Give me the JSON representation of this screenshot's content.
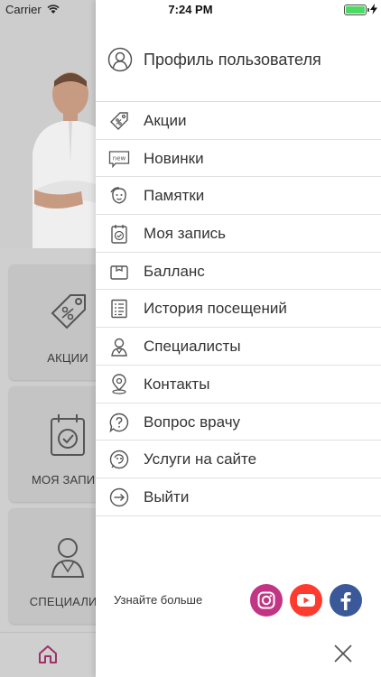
{
  "status_bar": {
    "carrier": "Carrier",
    "time": "7:24 PM",
    "battery_level": 1.0
  },
  "background": {
    "tiles": [
      {
        "label": "АКЦИИ",
        "icon": "tag-icon"
      },
      {
        "label": "МОЯ ЗАПИС",
        "icon": "calendar-check-icon"
      },
      {
        "label": "СПЕЦИАЛИС",
        "icon": "specialist-icon"
      }
    ],
    "bottom_nav": {
      "icon": "home-icon",
      "color": "#a0306a"
    }
  },
  "drawer": {
    "profile_label": "Профиль пользователя",
    "menu": [
      {
        "label": "Акции",
        "icon": "tag-icon"
      },
      {
        "label": "Новинки",
        "icon": "new-icon"
      },
      {
        "label": "Памятки",
        "icon": "memo-face-icon"
      },
      {
        "label": "Моя запись",
        "icon": "calendar-check-icon"
      },
      {
        "label": "Балланс",
        "icon": "wallet-icon"
      },
      {
        "label": "История посещений",
        "icon": "history-list-icon"
      },
      {
        "label": "Специалисты",
        "icon": "specialist-icon"
      },
      {
        "label": "Контакты",
        "icon": "location-pin-icon"
      },
      {
        "label": "Вопрос врачу",
        "icon": "question-bubble-icon"
      },
      {
        "label": "Услуги на сайте",
        "icon": "services-icon"
      },
      {
        "label": "Выйти",
        "icon": "logout-icon"
      }
    ],
    "learn_more": "Узнайте больше",
    "social": [
      {
        "name": "instagram",
        "color": "#c13584"
      },
      {
        "name": "youtube",
        "color": "#ff3b30"
      },
      {
        "name": "facebook",
        "color": "#3b5998"
      }
    ]
  }
}
